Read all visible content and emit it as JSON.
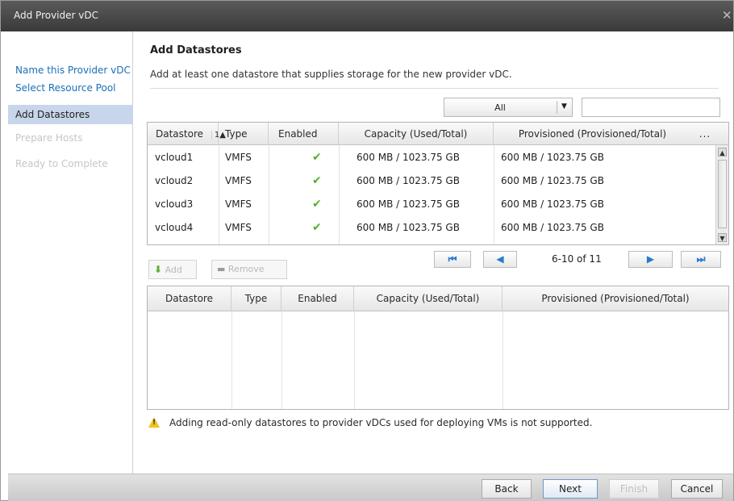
{
  "dialog": {
    "title": "Add Provider vDC",
    "close_glyph": "✕"
  },
  "nav": {
    "items": [
      {
        "label": "Name this Provider vDC",
        "state": "link"
      },
      {
        "label": "Select Resource Pool",
        "state": "link"
      },
      {
        "label": "Add Datastores",
        "state": "active"
      },
      {
        "label": "Prepare Hosts",
        "state": "disabled"
      },
      {
        "label": "Ready to Complete",
        "state": "disabled"
      }
    ]
  },
  "main": {
    "heading": "Add Datastores",
    "subtitle": "Add at least one datastore that supplies storage for the new provider vDC."
  },
  "filter": {
    "selected": "All",
    "search_value": ""
  },
  "available_table": {
    "columns": [
      "Datastore",
      "Type",
      "Enabled",
      "Capacity (Used/Total)",
      "Provisioned (Provisioned/Total)"
    ],
    "sort_indicator": "1▲",
    "more_glyph": "...",
    "rows": [
      {
        "datastore": "vcloud1",
        "type": "VMFS",
        "enabled": "✔",
        "capacity": "600 MB / 1023.75 GB",
        "provisioned": "600 MB / 1023.75 GB"
      },
      {
        "datastore": "vcloud2",
        "type": "VMFS",
        "enabled": "✔",
        "capacity": "600 MB / 1023.75 GB",
        "provisioned": "600 MB / 1023.75 GB"
      },
      {
        "datastore": "vcloud3",
        "type": "VMFS",
        "enabled": "✔",
        "capacity": "600 MB / 1023.75 GB",
        "provisioned": "600 MB / 1023.75 GB"
      },
      {
        "datastore": "vcloud4",
        "type": "VMFS",
        "enabled": "✔",
        "capacity": "600 MB / 1023.75 GB",
        "provisioned": "600 MB / 1023.75 GB"
      }
    ]
  },
  "pager": {
    "info": "6-10 of 11",
    "first": "⏮",
    "prev": "◀",
    "next": "▶",
    "last": "⏭"
  },
  "toolbar": {
    "add_label": "Add",
    "remove_label": "Remove"
  },
  "selected_table": {
    "columns": [
      "Datastore",
      "Type",
      "Enabled",
      "Capacity (Used/Total)",
      "Provisioned (Provisioned/Total)"
    ]
  },
  "warning": {
    "text": "Adding read-only datastores to provider vDCs used for deploying VMs is not supported."
  },
  "footer": {
    "back": "Back",
    "next": "Next",
    "finish": "Finish",
    "cancel": "Cancel"
  },
  "colors": {
    "link": "#1b6fb8",
    "active_nav": "#c7d6ea",
    "check": "#54b030",
    "warning": "#f1c21b"
  }
}
